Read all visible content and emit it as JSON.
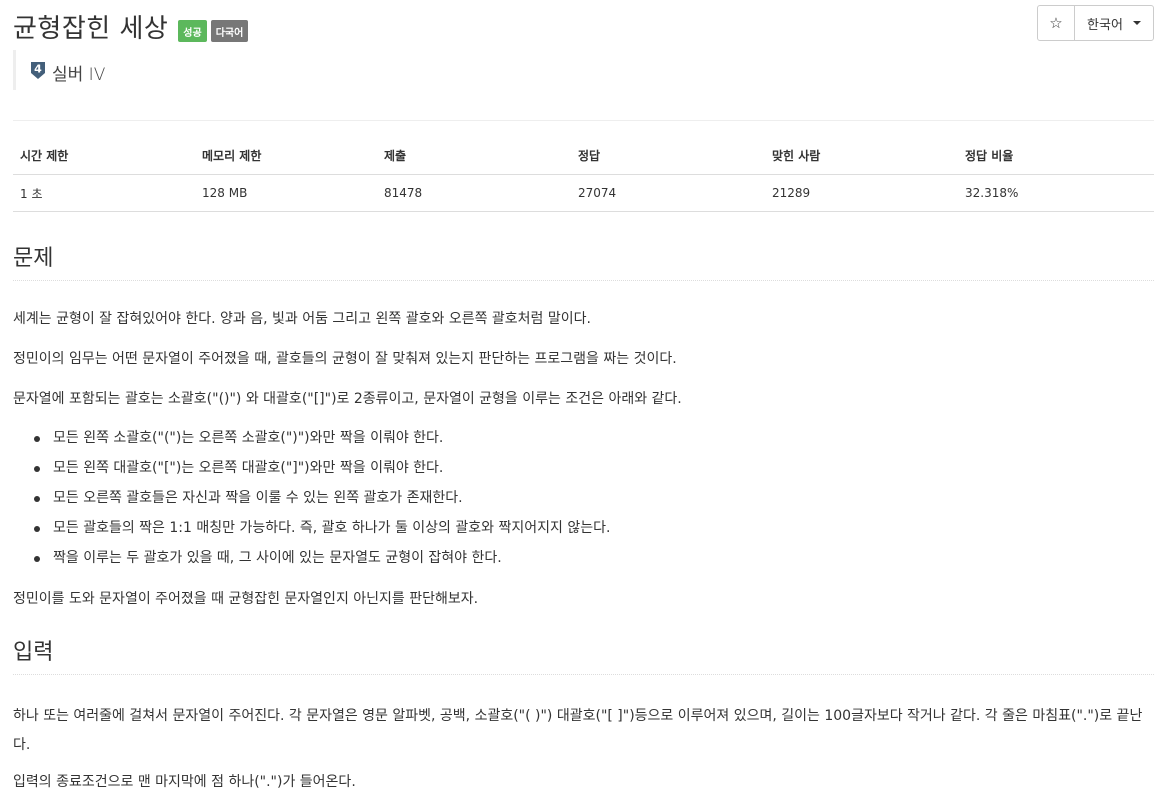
{
  "header": {
    "title": "균형잡힌 세상",
    "badges": {
      "success": "성공",
      "multilang": "다국어"
    },
    "tier": {
      "level": "4",
      "label": "실버 IV"
    },
    "star_icon": "star-icon",
    "language": "한국어"
  },
  "stats": {
    "headers": [
      "시간 제한",
      "메모리 제한",
      "제출",
      "정답",
      "맞힌 사람",
      "정답 비율"
    ],
    "values": [
      "1 초",
      "128 MB",
      "81478",
      "27074",
      "21289",
      "32.318%"
    ]
  },
  "problem": {
    "title": "문제",
    "p1": "세계는 균형이 잘 잡혀있어야 한다. 양과 음, 빛과 어둠 그리고 왼쪽 괄호와 오른쪽 괄호처럼 말이다.",
    "p2": "정민이의 임무는 어떤 문자열이 주어졌을 때, 괄호들의 균형이 잘 맞춰져 있는지 판단하는 프로그램을 짜는 것이다.",
    "p3": "문자열에 포함되는 괄호는 소괄호(\"()\") 와 대괄호(\"[]\")로 2종류이고, 문자열이 균형을 이루는 조건은 아래와 같다.",
    "rules": [
      "모든 왼쪽 소괄호(\"(\")는 오른쪽 소괄호(\")\")와만 짝을 이뤄야 한다.",
      "모든 왼쪽 대괄호(\"[\")는 오른쪽 대괄호(\"]\")와만 짝을 이뤄야 한다.",
      "모든 오른쪽 괄호들은 자신과 짝을 이룰 수 있는 왼쪽 괄호가 존재한다.",
      "모든 괄호들의 짝은 1:1 매칭만 가능하다. 즉, 괄호 하나가 둘 이상의 괄호와 짝지어지지 않는다.",
      "짝을 이루는 두 괄호가 있을 때, 그 사이에 있는 문자열도 균형이 잡혀야 한다."
    ],
    "p4": "정민이를 도와 문자열이 주어졌을 때 균형잡힌 문자열인지 아닌지를 판단해보자."
  },
  "input": {
    "title": "입력",
    "p1": "하나 또는 여러줄에 걸쳐서 문자열이 주어진다. 각 문자열은 영문 알파벳, 공백, 소괄호(\"( )\") 대괄호(\"[ ]\")등으로 이루어져 있으며, 길이는 100글자보다 작거나 같다. 각 줄은 마침표(\".\")로 끝난다.",
    "p2": "입력의 종료조건으로 맨 마지막에 점 하나(\".\")가 들어온다."
  }
}
